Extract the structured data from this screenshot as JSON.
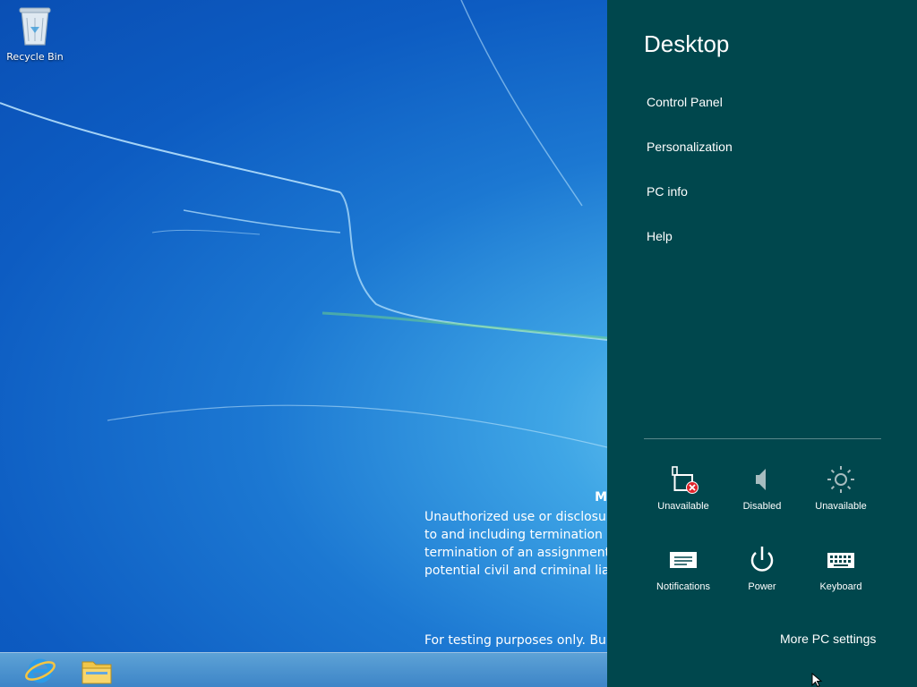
{
  "desktop": {
    "recycle_bin_label": "Recycle Bin",
    "notice": {
      "title": "M",
      "lines": [
        "Unauthorized use or disclosure",
        "to and including termination o",
        "termination of an assignment c",
        "potential civil and criminal liab"
      ]
    },
    "build_text": "For testing purposes only. Build"
  },
  "taskbar": {
    "icons": [
      "internet-explorer-icon",
      "file-explorer-icon"
    ]
  },
  "charm": {
    "title": "Desktop",
    "links": [
      "Control Panel",
      "Personalization",
      "PC info",
      "Help"
    ],
    "tiles": {
      "network": "Unavailable",
      "volume": "Disabled",
      "brightness": "Unavailable",
      "notifications": "Notifications",
      "power": "Power",
      "keyboard": "Keyboard"
    },
    "more_settings": "More PC settings",
    "background_color": "#00474d"
  },
  "colors": {
    "desktop_blue": "#1c78d2",
    "taskbar": "#4a93d0",
    "error_red": "#e0242b"
  }
}
